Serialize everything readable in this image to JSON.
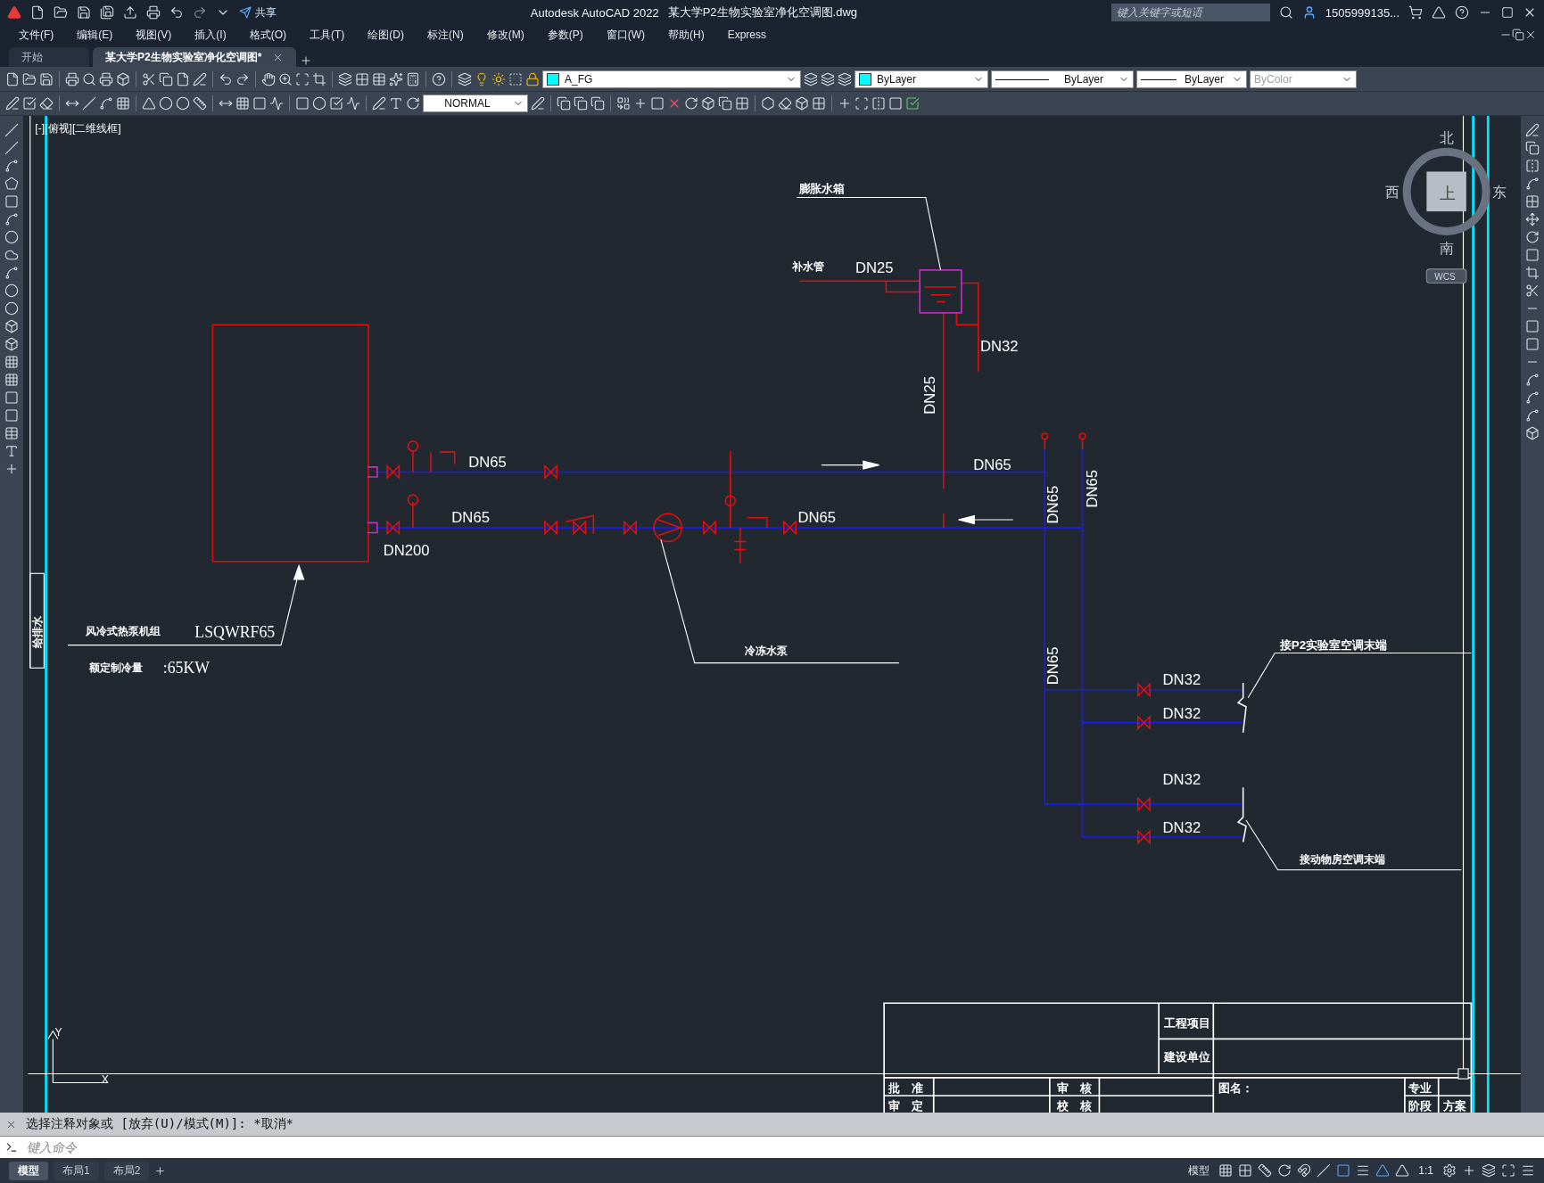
{
  "title_bar": {
    "share": "共享",
    "app": "Autodesk AutoCAD 2022",
    "document": "某大学P2生物实验室净化空调图.dwg",
    "search_placeholder": "键入关键字或短语",
    "user": "1505999135..."
  },
  "menu_bar": [
    "文件(F)",
    "编辑(E)",
    "视图(V)",
    "插入(I)",
    "格式(O)",
    "工具(T)",
    "绘图(D)",
    "标注(N)",
    "修改(M)",
    "参数(P)",
    "窗口(W)",
    "帮助(H)",
    "Express"
  ],
  "document_tabs": [
    {
      "label": "开始",
      "selected": false
    },
    {
      "label": "某大学P2生物实验室净化空调图*",
      "selected": true
    }
  ],
  "properties_toolbar": {
    "layer": "A_FG",
    "color_setting": "ByLayer",
    "linetype": "ByLayer",
    "lineweight": "ByLayer",
    "plot_style": "ByColor",
    "plot_style_disabled": true
  },
  "text_style": "NORMAL",
  "viewport": {
    "label": "[-][俯视][二维线框]",
    "viewcube": {
      "north": "北",
      "west": "西",
      "east": "东",
      "south": "南",
      "face": "上",
      "ucs": "WCS"
    },
    "axis_x": "X",
    "axis_y": "Y"
  },
  "drawing": {
    "side_label": "给排水",
    "labels": [
      "膨胀水箱",
      "补水管",
      "DN25",
      "DN32",
      "DN25",
      "DN65",
      "DN65",
      "DN65",
      "DN65",
      "DN200",
      "DN65",
      "DN65",
      "DN65",
      "DN32",
      "DN32",
      "DN32",
      "DN32",
      "接P2实验室空调末端",
      "接动物房空调末端",
      "冷冻水泵",
      "风冷式热泵机组",
      "LSQWRF65",
      "额定制冷量",
      ":65KW"
    ],
    "title_block": [
      "工程项目",
      "建设单位",
      "批　准",
      "审　核",
      "图名：",
      "专业",
      "审　定",
      "校　核",
      "阶段",
      "方案"
    ]
  },
  "command_line": {
    "history": "选择注释对象或 [放弃(U)/模式(M)]: *取消*",
    "placeholder": "键入命令"
  },
  "layout_tabs": [
    {
      "label": "模型",
      "selected": true
    },
    {
      "label": "布局1",
      "selected": false
    },
    {
      "label": "布局2",
      "selected": false
    }
  ],
  "status_bar": {
    "space": "模型",
    "scale": "1:1"
  }
}
